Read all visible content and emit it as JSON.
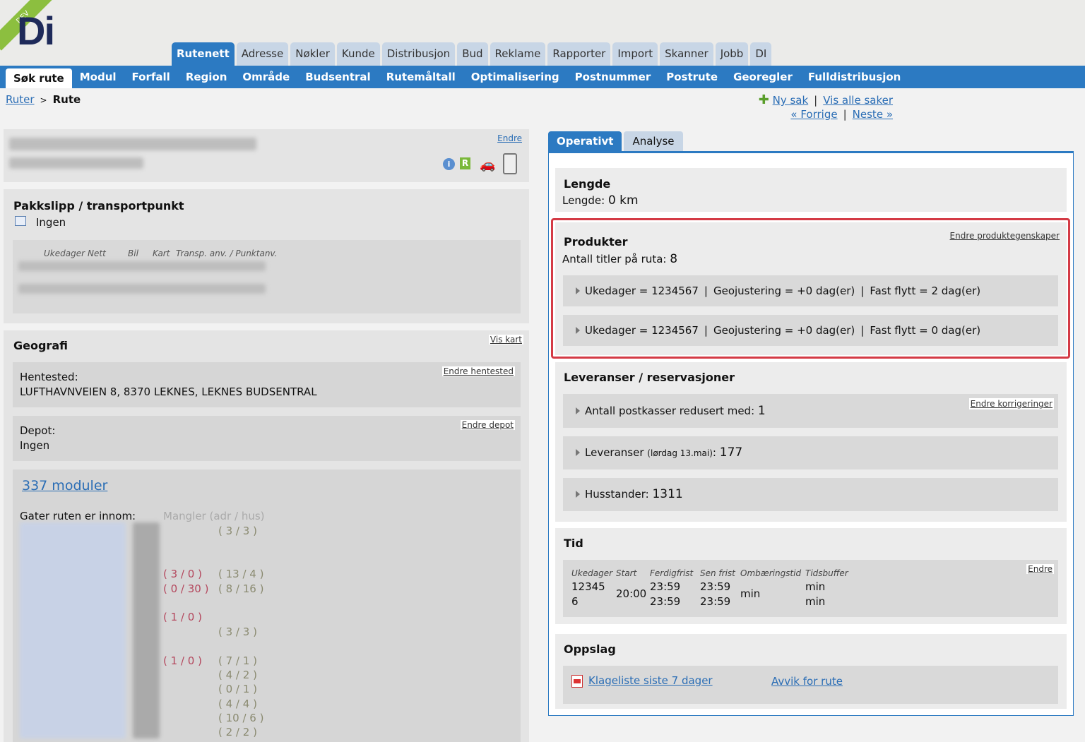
{
  "header": {
    "logo_text": "Di",
    "env_badge": "DEV",
    "top_tabs": [
      "Rutenett",
      "Adresse",
      "Nøkler",
      "Kunde",
      "Distribusjon",
      "Bud",
      "Reklame",
      "Rapporter",
      "Import",
      "Skanner",
      "Jobb",
      "DI"
    ],
    "active_top_tab": "Rutenett"
  },
  "subnav": {
    "items": [
      "Søk rute",
      "Modul",
      "Forfall",
      "Region",
      "Område",
      "Budsentral",
      "Rutemåltall",
      "Optimalisering",
      "Postnummer",
      "Postrute",
      "Georegler",
      "Fulldistribusjon"
    ],
    "active": "Søk rute"
  },
  "breadcrumb": {
    "parent": "Ruter",
    "separator": ">",
    "current": "Rute"
  },
  "top_links": {
    "new_case": "Ny sak",
    "all_cases": "Vis alle saker",
    "prev": "« Forrige",
    "next": "Neste »"
  },
  "route_box": {
    "edit": "Endre"
  },
  "pakkslipp": {
    "title": "Pakkslipp / transportpunkt",
    "value": "Ingen",
    "columns": [
      "Ukedager",
      "Nett",
      "Bil",
      "Kart",
      "Transp. anv. / Punktanv."
    ]
  },
  "geografi": {
    "title": "Geografi",
    "show_map": "Vis kart",
    "hentested_label": "Hentested:",
    "hentested_value": "LUFTHAVNVEIEN 8, 8370 LEKNES, LEKNES BUDSENTRAL",
    "hentested_edit": "Endre hentested",
    "depot_label": "Depot:",
    "depot_value": "Ingen",
    "depot_edit": "Endre depot",
    "modules_link": "337 moduler",
    "streets_label": "Gater ruten er innom:",
    "missing_label": "Mangler (adr / hus)",
    "street_rows": [
      {
        "red": "",
        "grey": "( 3 / 3 )"
      },
      {
        "red": "",
        "grey": ""
      },
      {
        "red": "",
        "grey": ""
      },
      {
        "red": "( 3 / 0 )",
        "grey": "( 13 / 4 )"
      },
      {
        "red": "( 0 / 30 )",
        "grey": "( 8 / 16 )"
      },
      {
        "red": "",
        "grey": ""
      },
      {
        "red": "( 1 / 0 )",
        "grey": ""
      },
      {
        "red": "",
        "grey": "( 3 / 3 )"
      },
      {
        "red": "",
        "grey": ""
      },
      {
        "red": "( 1 / 0 )",
        "grey": "( 7 / 1 )"
      },
      {
        "red": "",
        "grey": "( 4 / 2 )"
      },
      {
        "red": "",
        "grey": "( 0 / 1 )"
      },
      {
        "red": "",
        "grey": "( 4 / 4 )"
      },
      {
        "red": "",
        "grey": "( 10 / 6 )"
      },
      {
        "red": "",
        "grey": "( 2 / 2 )"
      }
    ]
  },
  "right_tabs": [
    "Operativt",
    "Analyse"
  ],
  "lengde": {
    "title": "Lengde",
    "label": "Lengde:",
    "value": "0 km"
  },
  "produkter": {
    "title": "Produkter",
    "edit": "Endre produktegenskaper",
    "count_label": "Antall titler på ruta:",
    "count": "8",
    "rows": [
      {
        "ukedager": "Ukedager = 1234567",
        "geo": "Geojustering = +0 dag(er)",
        "flytt": "Fast flytt = 2 dag(er)"
      },
      {
        "ukedager": "Ukedager = 1234567",
        "geo": "Geojustering = +0 dag(er)",
        "flytt": "Fast flytt = 0 dag(er)"
      }
    ]
  },
  "leveranser": {
    "title": "Leveranser / reservasjoner",
    "edit": "Endre korrigeringer",
    "postkasser_label": "Antall postkasser redusert med:",
    "postkasser_value": "1",
    "leveranser_label": "Leveranser",
    "leveranser_date": "(lørdag 13.mai)",
    "leveranser_value": "177",
    "husstander_label": "Husstander:",
    "husstander_value": "1311"
  },
  "tid": {
    "title": "Tid",
    "edit": "Endre",
    "headers": [
      "Ukedager",
      "Start",
      "Ferdigfrist",
      "Sen frist",
      "Ombæringstid",
      "Tidsbuffer"
    ],
    "ukedager": [
      "12345",
      "6"
    ],
    "start": "20:00",
    "ferdigfrist": [
      "23:59",
      "23:59"
    ],
    "sen_frist": [
      "23:59",
      "23:59"
    ],
    "ombaering": "min",
    "tidsbuffer": [
      "min",
      "min"
    ]
  },
  "oppslag": {
    "title": "Oppslag",
    "klage": "Klageliste siste 7 dager",
    "avvik": "Avvik for rute"
  }
}
